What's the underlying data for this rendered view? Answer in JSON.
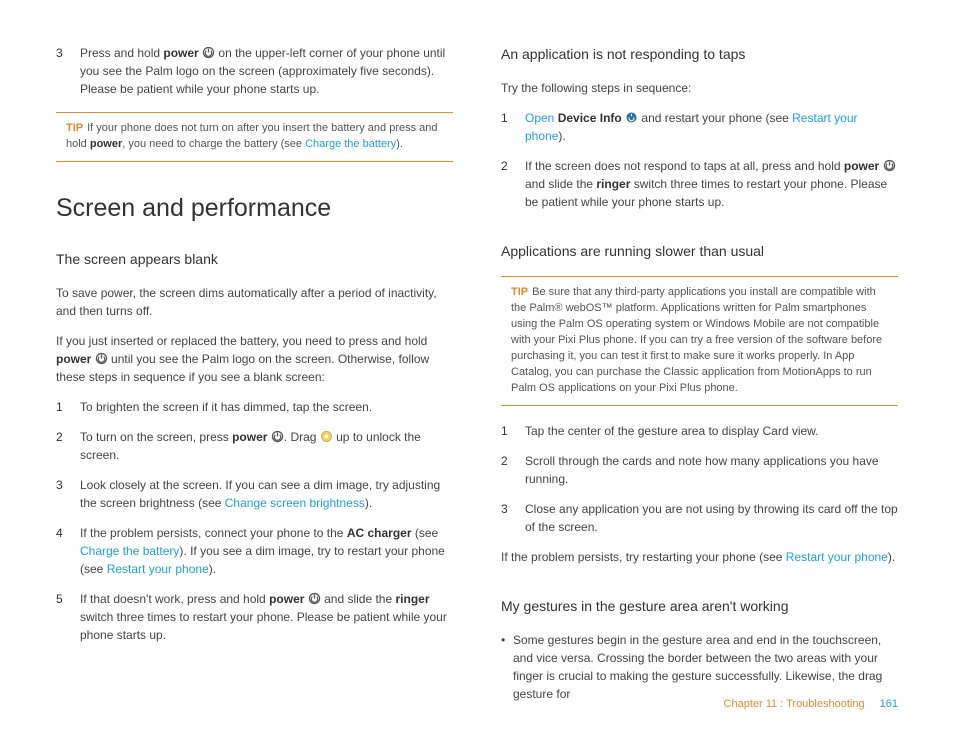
{
  "left": {
    "step3_num": "3",
    "step3_a": "Press and hold ",
    "step3_b": "power",
    "step3_c": " on the upper-left corner of your phone until you see the Palm logo on the screen (approximately five seconds). Please be patient while your phone starts up.",
    "tip1_label": "TIP",
    "tip1_a": "If your phone does not turn on after you insert the battery and press and hold ",
    "tip1_b": "power",
    "tip1_c": ", you need to charge the battery (see ",
    "tip1_link": "Charge the battery",
    "tip1_d": ").",
    "h1": "Screen and performance",
    "h2a": "The screen appears blank",
    "p1": "To save power, the screen dims automatically after a period of inactivity, and then turns off.",
    "p2a": "If you just inserted or replaced the battery, you need to press and hold ",
    "p2b": "power",
    "p2c": " until you see the Palm logo on the screen. Otherwise, follow these steps in sequence if you see a blank screen:",
    "s1n": "1",
    "s1": "To brighten the screen if it has dimmed, tap the screen.",
    "s2n": "2",
    "s2a": "To turn on the screen, press ",
    "s2b": "power",
    "s2c": ". Drag ",
    "s2d": " up to unlock the screen.",
    "s3n": "3",
    "s3a": "Look closely at the screen. If you can see a dim image, try adjusting the screen brightness (see ",
    "s3link": "Change screen brightness",
    "s3b": ").",
    "s4n": "4",
    "s4a": "If the problem persists, connect your phone to the ",
    "s4b": "AC charger",
    "s4c": " (see ",
    "s4link1": "Charge the battery",
    "s4d": "). If you see a dim image, try to restart your phone (see ",
    "s4link2": "Restart your phone",
    "s4e": ").",
    "s5n": "5",
    "s5a": "If that doesn't work, press and hold ",
    "s5b": "power",
    "s5c": " and slide the ",
    "s5d": "ringer",
    "s5e": " switch three times to restart your phone. Please be patient while your phone starts up."
  },
  "right": {
    "h2a": "An application is not responding to taps",
    "p1": "Try the following steps in sequence:",
    "r1n": "1",
    "r1open": "Open",
    "r1a": " ",
    "r1b": "Device Info",
    "r1c": " and restart your phone (see ",
    "r1link": "Restart your phone",
    "r1d": ").",
    "r2n": "2",
    "r2a": "If the screen does not respond to taps at all, press and hold ",
    "r2b": "power",
    "r2c": " and slide the ",
    "r2d": "ringer",
    "r2e": " switch three times to restart your phone. Please be patient while your phone starts up.",
    "h2b": "Applications are running slower than usual",
    "tip2_label": "TIP",
    "tip2": "Be sure that any third-party applications you install are compatible with the Palm® webOS™ platform. Applications written for Palm smartphones using the Palm OS operating system or Windows Mobile are not compatible with your Pixi Plus phone. If you can try a free version of the software before purchasing it, you can test it first to make sure it works properly. In App Catalog, you can purchase the Classic application from MotionApps to run Palm OS applications on your Pixi Plus phone.",
    "b1n": "1",
    "b1": "Tap the center of the gesture area to display Card view.",
    "b2n": "2",
    "b2": "Scroll through the cards and note how many applications you have running.",
    "b3n": "3",
    "b3": "Close any application you are not using by throwing its card off the top of the screen.",
    "p2a": "If the problem persists, try restarting your phone (see ",
    "p2link": "Restart your phone",
    "p2b": ").",
    "h2c": "My gestures in the gesture area aren't working",
    "bullet": "•",
    "g1": "Some gestures begin in the gesture area and end in the touchscreen, and vice versa. Crossing the border between the two areas with your finger is crucial to making the gesture successfully. Likewise, the drag gesture for"
  },
  "footer": {
    "chapter": "Chapter 11 : Troubleshooting",
    "page": "161"
  }
}
